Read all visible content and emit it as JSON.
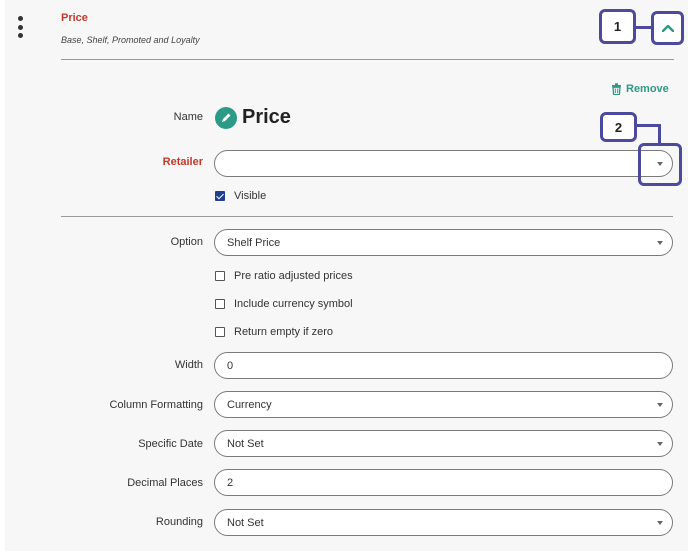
{
  "header": {
    "title": "Price",
    "subtitle": "Base, Shelf, Promoted and Loyalty"
  },
  "callouts": {
    "one": "1",
    "two": "2"
  },
  "actions": {
    "remove_label": "Remove"
  },
  "fields": {
    "name_label": "Name",
    "name_value": "Price",
    "retailer_label": "Retailer",
    "retailer_value": "",
    "visible_label": "Visible",
    "visible_checked": true,
    "option_label": "Option",
    "option_value": "Shelf Price",
    "pre_ratio_label": "Pre ratio adjusted prices",
    "pre_ratio_checked": false,
    "currency_symbol_label": "Include currency symbol",
    "currency_symbol_checked": false,
    "return_empty_label": "Return empty if zero",
    "return_empty_checked": false,
    "width_label": "Width",
    "width_value": "0",
    "column_formatting_label": "Column Formatting",
    "column_formatting_value": "Currency",
    "specific_date_label": "Specific Date",
    "specific_date_value": "Not Set",
    "decimal_places_label": "Decimal Places",
    "decimal_places_value": "2",
    "rounding_label": "Rounding",
    "rounding_value": "Not Set"
  },
  "colors": {
    "accent_teal": "#2c9a86",
    "title_red": "#c0392b",
    "callout_indigo": "#4b4a9c",
    "checkbox_blue": "#1f3f8f"
  },
  "icons": {
    "menu": "kebab-menu-icon",
    "collapse": "chevron-up-icon",
    "remove": "trash-icon",
    "name": "pencil-circle-icon",
    "dropdown": "caret-down-icon"
  }
}
